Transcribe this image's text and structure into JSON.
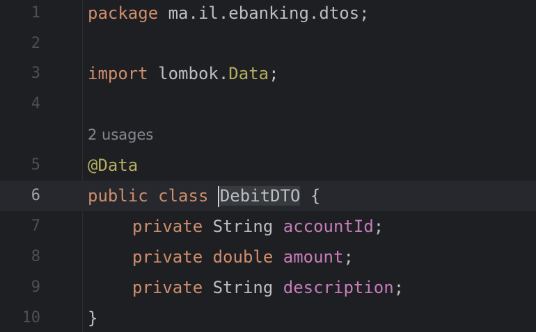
{
  "editor": {
    "language": "java",
    "current_line": "6",
    "colors": {
      "background": "#1e1f22",
      "current_line_bg": "#26282e",
      "keyword": "#cf8e6d",
      "annotation": "#b3ae60",
      "field": "#c77dbb",
      "text": "#bcbec4",
      "line_number": "#4b5059",
      "inlay_hint": "#868a91"
    },
    "lines": {
      "l1": {
        "num": "1",
        "kw": "package",
        "rest": " ma.il.ebanking.dtos;"
      },
      "l2": {
        "num": "2"
      },
      "l3": {
        "num": "3",
        "kw": "import",
        "pkg": " lombok.",
        "ann": "Data",
        "end": ";"
      },
      "l4": {
        "num": "4"
      },
      "hint": {
        "text": "2 usages"
      },
      "l5": {
        "num": "5",
        "ann": "@Data"
      },
      "l6": {
        "num": "6",
        "kw": "public class",
        "sp": " ",
        "ident": "DebitDTO",
        "rest": " {"
      },
      "l7": {
        "num": "7",
        "kw": "private",
        "type": " String ",
        "field": "accountId",
        "end": ";"
      },
      "l8": {
        "num": "8",
        "kw": "private double",
        "sp": " ",
        "field": "amount",
        "end": ";"
      },
      "l9": {
        "num": "9",
        "kw": "private",
        "type": " String ",
        "field": "description",
        "end": ";"
      },
      "l10": {
        "num": "10",
        "brace": "}"
      }
    }
  }
}
